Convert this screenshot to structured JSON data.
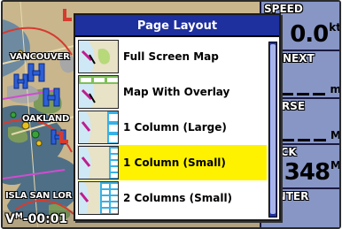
{
  "dialog": {
    "title": "Page Layout",
    "options": [
      {
        "label": "Full Screen Map",
        "selected": false,
        "thumb": "map-full"
      },
      {
        "label": "Map With Overlay",
        "selected": false,
        "thumb": "map-overlay"
      },
      {
        "label": "1 Column (Large)",
        "selected": false,
        "thumb": "map-1col-large"
      },
      {
        "label": "1 Column (Small)",
        "selected": true,
        "thumb": "map-1col-small"
      },
      {
        "label": "2 Columns (Small)",
        "selected": false,
        "thumb": "map-2col-small"
      }
    ]
  },
  "map": {
    "labels": [
      "VANCOUVER",
      "OAKLAND",
      "ISLA SAN LOR"
    ],
    "elapsed": {
      "prefix": "V",
      "sub": "M",
      "value": "-00:01"
    }
  },
  "fields": [
    {
      "label": "SPEED",
      "value": "0.0",
      "unit": "kt"
    },
    {
      "label": "ST NEXT",
      "value": "",
      "unit": "m"
    },
    {
      "label": "OURSE",
      "value": "",
      "unit": "M"
    },
    {
      "label": "RACK",
      "value": "348",
      "unit": "M"
    },
    {
      "label": "OINTER",
      "value": "",
      "unit": ""
    }
  ],
  "colors": {
    "dialog_title_bg": "#1e2f9e",
    "selection": "#fff200",
    "field_bg": "#8896c6",
    "map_bg": "#bfae8a"
  }
}
